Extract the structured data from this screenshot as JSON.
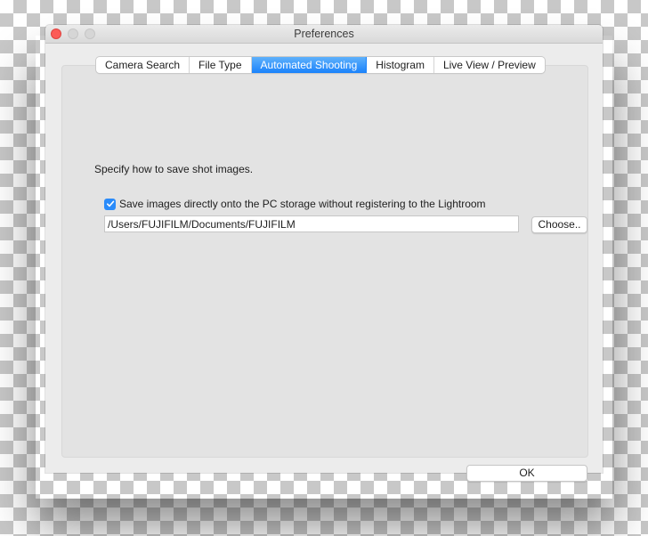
{
  "window": {
    "title": "Preferences",
    "controls": [
      "close",
      "minimize",
      "maximize"
    ]
  },
  "tabs": [
    {
      "label": "Camera Search",
      "active": false
    },
    {
      "label": "File Type",
      "active": false
    },
    {
      "label": "Automated Shooting",
      "active": true
    },
    {
      "label": "Histogram",
      "active": false
    },
    {
      "label": "Live View / Preview",
      "active": false
    }
  ],
  "content": {
    "instruction": "Specify how to save shot images.",
    "save_direct": {
      "label": "Save images directly onto the PC storage without registering to the Lightroom",
      "checked": true
    },
    "path_value": "/Users/FUJIFILM/Documents/FUJIFILM",
    "choose_label": "Choose..",
    "ok_label": "OK"
  },
  "colors": {
    "accent": "#1a82fb",
    "close_button": "#fc5b57"
  }
}
